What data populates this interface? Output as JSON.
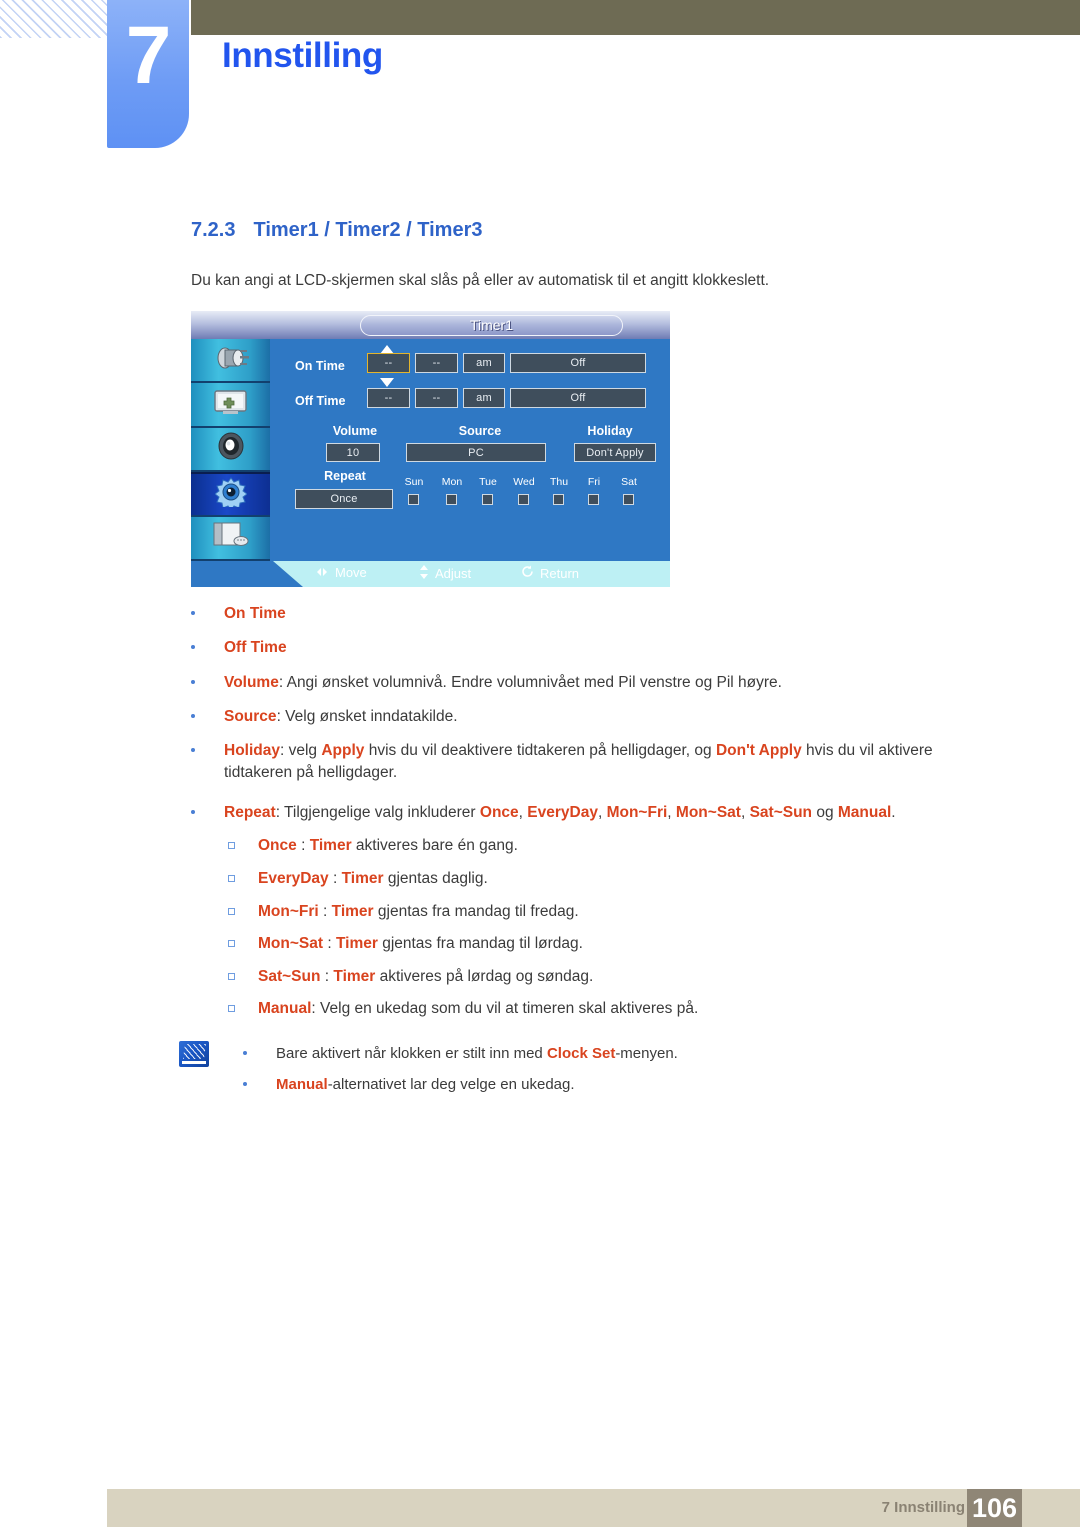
{
  "header": {
    "chapter_number": "7",
    "chapter_title": "Innstilling"
  },
  "section": {
    "number": "7.2.3",
    "title": "Timer1 / Timer2 / Timer3",
    "intro": "Du kan angi at LCD-skjermen skal slås på eller av automatisk til et angitt klokkeslett."
  },
  "osd": {
    "title": "Timer1",
    "sidebar_icons": [
      "input-source-icon",
      "picture-display-icon",
      "sound-speaker-icon",
      "setup-gear-icon",
      "support-document-icon"
    ],
    "on_time": {
      "label": "On Time",
      "hour": "--",
      "minute": "--",
      "meridiem": "am",
      "state": "Off"
    },
    "off_time": {
      "label": "Off Time",
      "hour": "--",
      "minute": "--",
      "meridiem": "am",
      "state": "Off"
    },
    "volume": {
      "label": "Volume",
      "value": "10"
    },
    "source": {
      "label": "Source",
      "value": "PC"
    },
    "holiday": {
      "label": "Holiday",
      "value": "Don't Apply"
    },
    "repeat": {
      "label": "Repeat",
      "value": "Once"
    },
    "days": [
      "Sun",
      "Mon",
      "Tue",
      "Wed",
      "Thu",
      "Fri",
      "Sat"
    ],
    "footer": {
      "move": "Move",
      "adjust": "Adjust",
      "return": "Return"
    }
  },
  "bullets": [
    {
      "text_html": "<span class=\"kw\">On Time</span>"
    },
    {
      "text_html": "<span class=\"kw\">Off Time</span>"
    },
    {
      "text_html": "<span class=\"kw\">Volume</span>: Angi ønsket volumnivå. Endre volumnivået med Pil venstre og Pil høyre."
    },
    {
      "text_html": "<span class=\"kw\">Source</span>: Velg ønsket inndatakilde."
    },
    {
      "text_html": "<span class=\"kw\">Holiday</span>: velg <span class=\"kw\">Apply</span> hvis du vil deaktivere tidtakeren på helligdager, og <span class=\"kw\">Don't Apply</span> hvis du vil aktivere tidtakeren på helligdager."
    },
    {
      "text_html": "<span class=\"kw\">Repeat</span>: Tilgjengelige valg inkluderer <span class=\"kw\">Once</span>, <span class=\"kw\">EveryDay</span>, <span class=\"kw\">Mon~Fri</span>, <span class=\"kw\">Mon~Sat</span>, <span class=\"kw\">Sat~Sun</span> og <span class=\"kw\">Manual</span>."
    }
  ],
  "subbullets": [
    {
      "text_html": "<span class=\"kw\">Once</span> : <span class=\"kw\">Timer</span> aktiveres bare én gang."
    },
    {
      "text_html": "<span class=\"kw\">EveryDay</span> : <span class=\"kw\">Timer</span> gjentas daglig."
    },
    {
      "text_html": "<span class=\"kw\">Mon~Fri</span> : <span class=\"kw\">Timer</span> gjentas fra mandag til fredag."
    },
    {
      "text_html": "<span class=\"kw\">Mon~Sat</span> : <span class=\"kw\">Timer</span> gjentas fra mandag til lørdag."
    },
    {
      "text_html": "<span class=\"kw\">Sat~Sun</span> : <span class=\"kw\">Timer</span> aktiveres på lørdag og søndag."
    },
    {
      "text_html": "<span class=\"kw\">Manual</span>: Velg en ukedag som du vil at timeren skal aktiveres på."
    }
  ],
  "note": {
    "icon": "note-pen-icon",
    "items": [
      {
        "text_html": "Bare aktivert når klokken er stilt inn med <span class=\"kw\">Clock Set</span>-menyen."
      },
      {
        "text_html": "<span class=\"kw\">Manual</span>-alternativet lar deg velge en ukedag."
      }
    ]
  },
  "footer": {
    "label": "7 Innstilling",
    "page": "106"
  },
  "colors": {
    "chapter_tab": "#6e9cf5",
    "chapter_title": "#2255ee",
    "olive_bar": "#6e6b54",
    "section_heading": "#2f63c8",
    "keyword": "#d9441f",
    "bullet_dot": "#4a7fd4",
    "osd_panel": "#2f78c4",
    "osd_field": "#3f4e5c",
    "osd_selected_border": "#e3b52e",
    "osd_footbar": "#bdf0f4",
    "footer_bar": "#d9d3c0",
    "footer_page_box": "#8f8676"
  }
}
